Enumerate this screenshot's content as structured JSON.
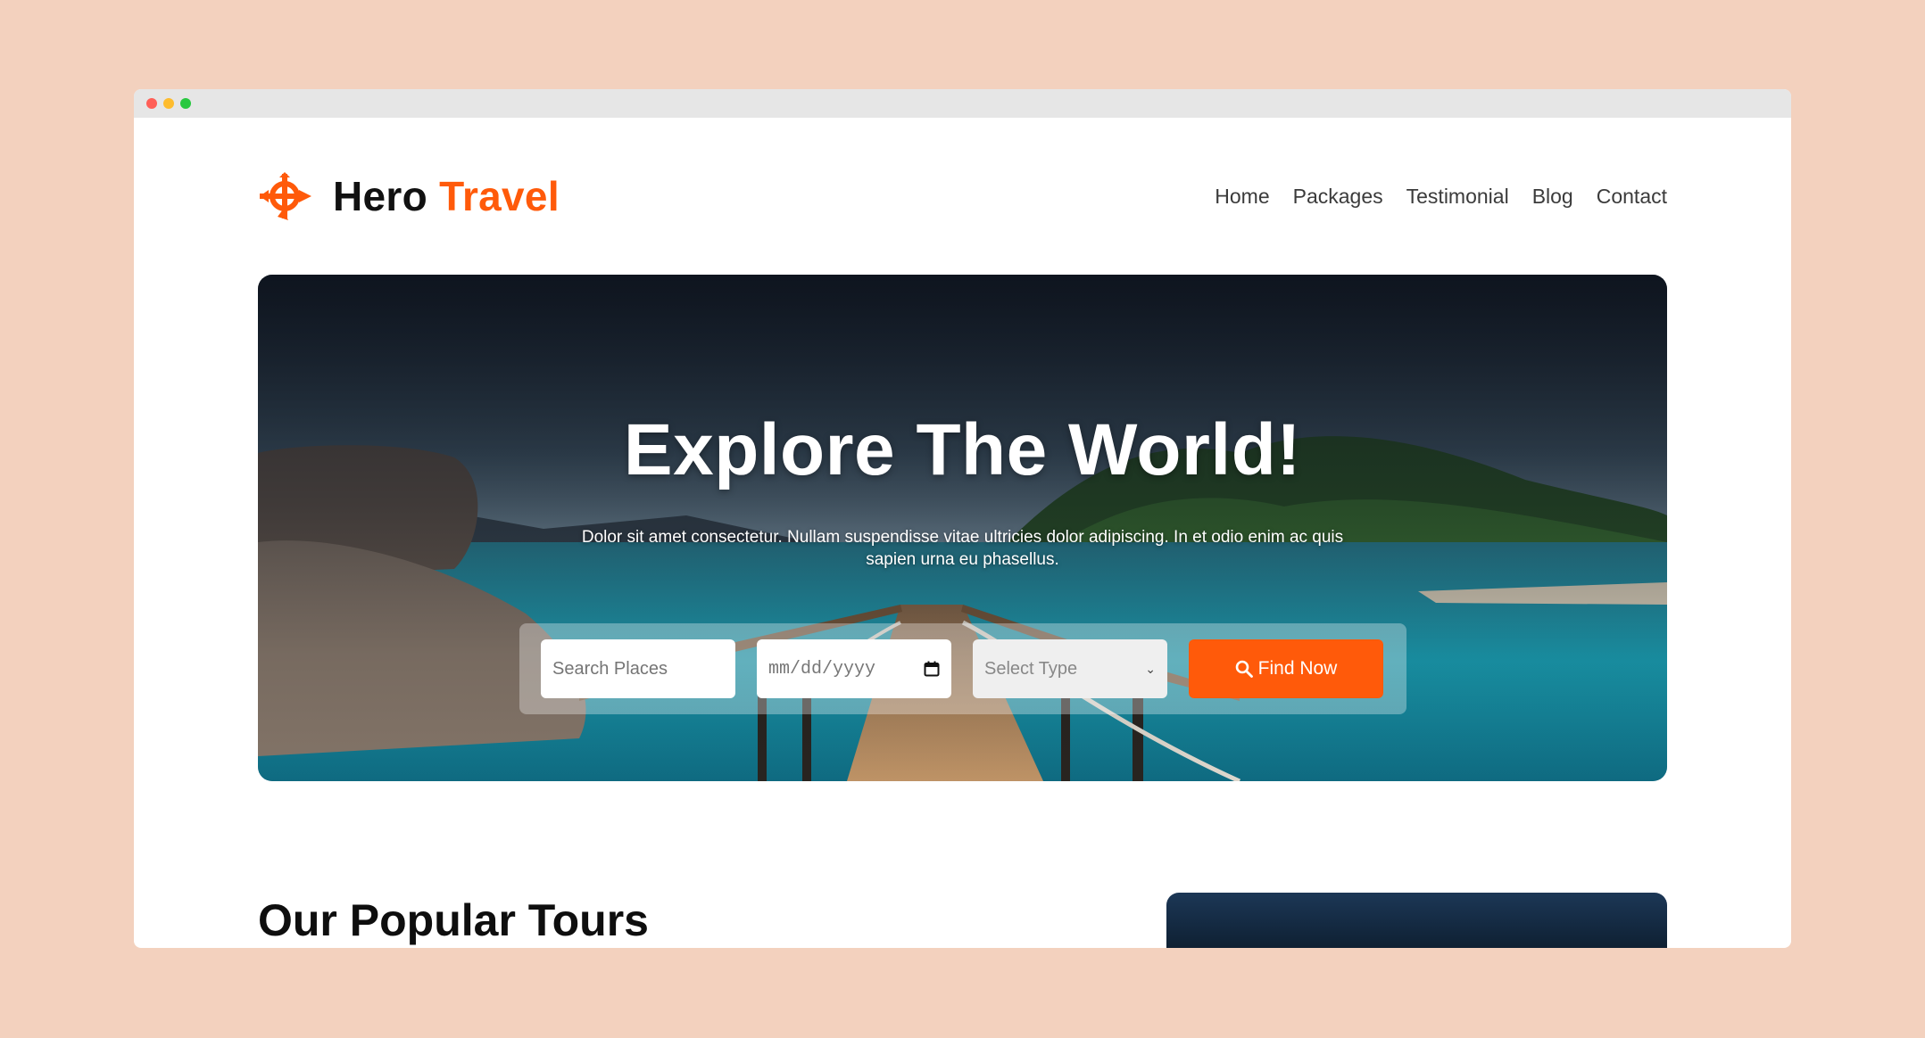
{
  "brand": {
    "name_part1": "Hero",
    "name_part2": "Travel",
    "accent_color": "#ff5a0a"
  },
  "nav": {
    "items": [
      "Home",
      "Packages",
      "Testimonial",
      "Blog",
      "Contact"
    ]
  },
  "hero": {
    "title": "Explore The World!",
    "subtitle": "Dolor sit amet consectetur. Nullam suspendisse vitae ultricies dolor adipiscing. In et odio enim ac quis sapien urna eu phasellus."
  },
  "search": {
    "places_placeholder": "Search Places",
    "date_placeholder": "mm/dd/yyyy",
    "type_selected": "Select Type",
    "button_label": "Find Now"
  },
  "sections": {
    "popular_tours_title": "Our Popular Tours"
  },
  "icons": {
    "logo": "compass-plane-logo-icon",
    "calendar": "calendar-icon",
    "chevron": "chevron-down-icon",
    "search": "search-icon"
  }
}
